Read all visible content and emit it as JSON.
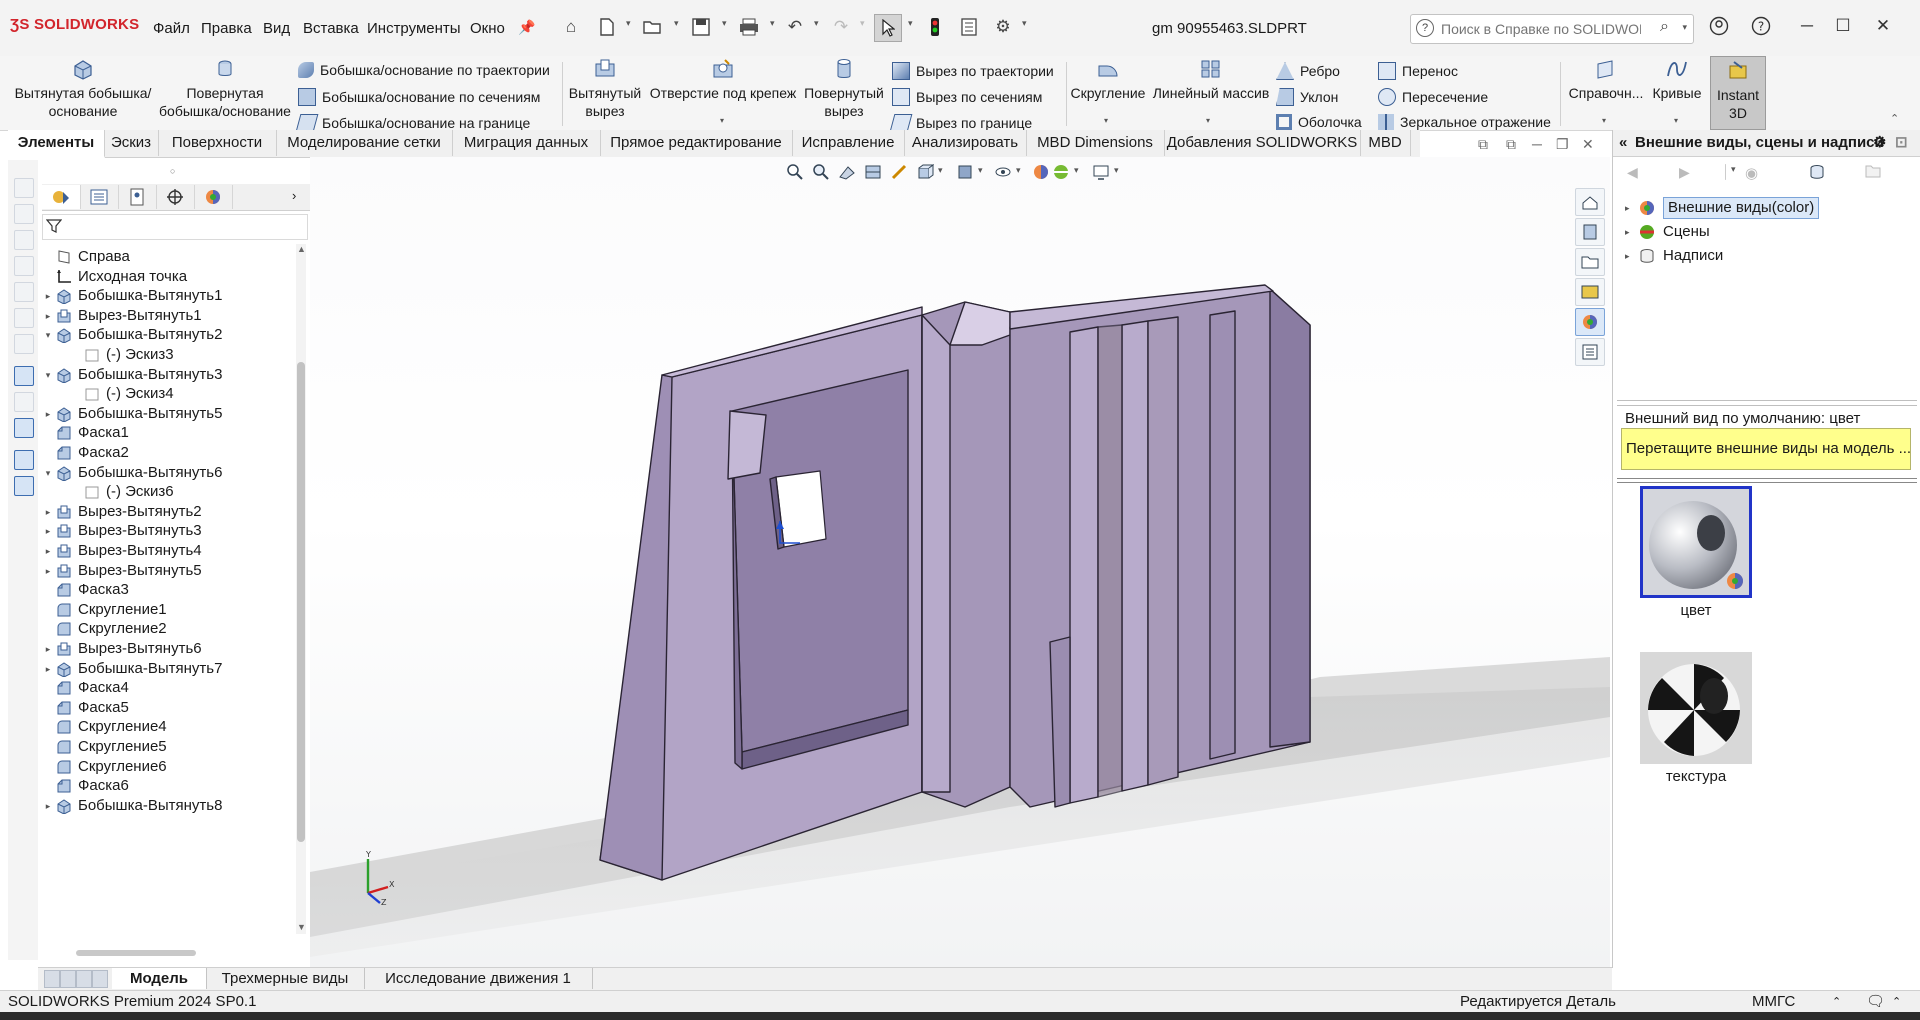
{
  "app": {
    "logo": "SOLIDWORKS",
    "document_title": "gm 90955463.SLDPRT"
  },
  "menu": [
    "Файл",
    "Правка",
    "Вид",
    "Вставка",
    "Инструменты",
    "Окно"
  ],
  "help_search": {
    "placeholder": "Поиск в Справке по SOLIDWORKS"
  },
  "features": {
    "extrude_boss": "Вытянутая бобышка/основание",
    "revolve_boss": "Повернутая бобышка/основание",
    "sweep_boss": "Бобышка/основание по траектории",
    "loft_boss": "Бобышка/основание по сечениям",
    "boundary_boss": "Бобышка/основание на границе",
    "extrude_cut": "Вытянутый вырез",
    "hole_wizard": "Отверстие под крепеж",
    "revolve_cut": "Повернутый вырез",
    "sweep_cut": "Вырез по траектории",
    "loft_cut": "Вырез по сечениям",
    "boundary_cut": "Вырез по границе",
    "fillet": "Скругление",
    "linear_pattern": "Линейный массив",
    "rib": "Ребро",
    "draft": "Уклон",
    "shell": "Оболочка",
    "wrap": "Перенос",
    "intersect": "Пересечение",
    "mirror": "Зеркальное отражение",
    "reference": "Справочн...",
    "curves": "Кривые",
    "instant3d": "Instant 3D"
  },
  "cm_tabs": [
    "Элементы",
    "Эскиз",
    "Поверхности",
    "Моделирование сетки",
    "Миграция данных",
    "Прямое редактирование",
    "Исправление",
    "Анализировать",
    "MBD Dimensions",
    "Добавления SOLIDWORKS",
    "MBD"
  ],
  "tree": [
    {
      "label": "Справа",
      "icon": "plane-icon",
      "expander": ""
    },
    {
      "label": "Исходная точка",
      "icon": "origin-icon",
      "expander": ""
    },
    {
      "label": "Бобышка-Вытянуть1",
      "icon": "extrude-icon",
      "expander": "▸"
    },
    {
      "label": "Вырез-Вытянуть1",
      "icon": "cut-icon",
      "expander": "▸"
    },
    {
      "label": "Бобышка-Вытянуть2",
      "icon": "extrude-icon",
      "expander": "▾"
    },
    {
      "label": "(-) Эскиз3",
      "icon": "sketch-icon",
      "expander": "",
      "indent": 1
    },
    {
      "label": "Бобышка-Вытянуть3",
      "icon": "extrude-icon",
      "expander": "▾"
    },
    {
      "label": "(-) Эскиз4",
      "icon": "sketch-icon",
      "expander": "",
      "indent": 1
    },
    {
      "label": "Бобышка-Вытянуть5",
      "icon": "extrude-icon",
      "expander": "▸"
    },
    {
      "label": "Фаска1",
      "icon": "chamfer-icon",
      "expander": ""
    },
    {
      "label": "Фаска2",
      "icon": "chamfer-icon",
      "expander": ""
    },
    {
      "label": "Бобышка-Вытянуть6",
      "icon": "extrude-icon",
      "expander": "▾"
    },
    {
      "label": "(-) Эскиз6",
      "icon": "sketch-icon",
      "expander": "",
      "indent": 1
    },
    {
      "label": "Вырез-Вытянуть2",
      "icon": "cut-icon",
      "expander": "▸"
    },
    {
      "label": "Вырез-Вытянуть3",
      "icon": "cut-icon",
      "expander": "▸"
    },
    {
      "label": "Вырез-Вытянуть4",
      "icon": "cut-icon",
      "expander": "▸"
    },
    {
      "label": "Вырез-Вытянуть5",
      "icon": "cut-icon",
      "expander": "▸"
    },
    {
      "label": "Фаска3",
      "icon": "chamfer-icon",
      "expander": ""
    },
    {
      "label": "Скругление1",
      "icon": "fillet-icon",
      "expander": ""
    },
    {
      "label": "Скругление2",
      "icon": "fillet-icon",
      "expander": ""
    },
    {
      "label": "Вырез-Вытянуть6",
      "icon": "cut-icon",
      "expander": "▸"
    },
    {
      "label": "Бобышка-Вытянуть7",
      "icon": "extrude-icon",
      "expander": "▸"
    },
    {
      "label": "Фаска4",
      "icon": "chamfer-icon",
      "expander": ""
    },
    {
      "label": "Фаска5",
      "icon": "chamfer-icon",
      "expander": ""
    },
    {
      "label": "Скругление4",
      "icon": "fillet-icon",
      "expander": ""
    },
    {
      "label": "Скругление5",
      "icon": "fillet-icon",
      "expander": ""
    },
    {
      "label": "Скругление6",
      "icon": "fillet-icon",
      "expander": ""
    },
    {
      "label": "Фаска6",
      "icon": "chamfer-icon",
      "expander": ""
    },
    {
      "label": "Бобышка-Вытянуть8",
      "icon": "extrude-icon",
      "expander": "▸"
    }
  ],
  "taskpane": {
    "title": "Внешние виды, сцены и надписи",
    "nodes": [
      "Внешние виды(color)",
      "Сцены",
      "Надписи"
    ],
    "default_label": "Внешний вид по умолчанию: цвет",
    "hint": "Перетащите внешние виды на модель ...",
    "swatches": [
      "цвет",
      "текстура"
    ]
  },
  "bottom_tabs": [
    "Модель",
    "Трехмерные виды",
    "Исследование движения 1"
  ],
  "status": {
    "left": "SOLIDWORKS Premium 2024 SP0.1",
    "editing": "Редактируется Деталь",
    "units": "ММГС"
  },
  "colors": {
    "part": "#a597b9",
    "accent": "#3d6db0",
    "brand": "#c8102e"
  }
}
